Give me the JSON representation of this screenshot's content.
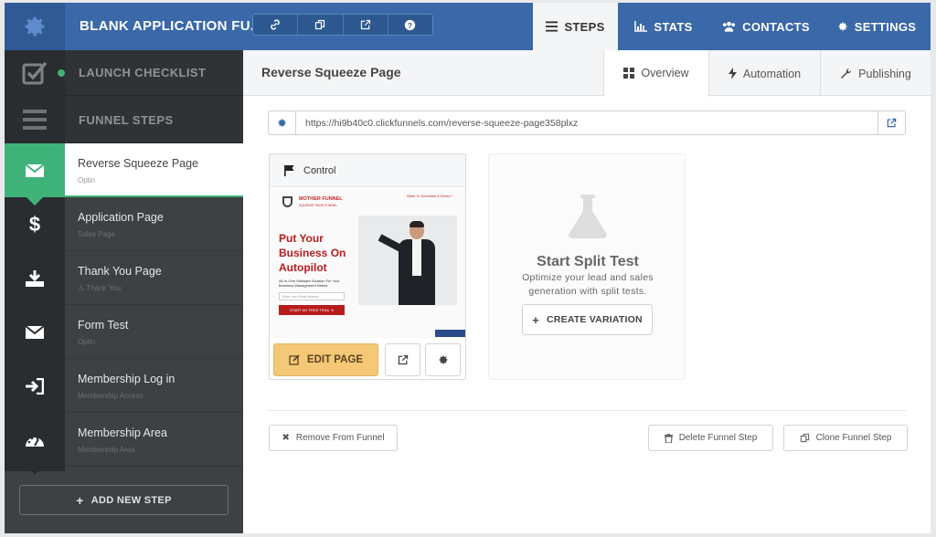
{
  "app": {
    "title": "BLANK APPLICATION FU..."
  },
  "top_nav": [
    {
      "label": "STEPS",
      "icon": "bars-icon"
    },
    {
      "label": "STATS",
      "icon": "bar-chart-icon"
    },
    {
      "label": "CONTACTS",
      "icon": "users-icon"
    },
    {
      "label": "SETTINGS",
      "icon": "gear-icon"
    }
  ],
  "quick_icons": [
    "link-icon",
    "copy-icon",
    "external-link-icon",
    "help-icon"
  ],
  "sidebar": {
    "launch_checklist": "LAUNCH CHECKLIST",
    "funnel_steps": "FUNNEL STEPS",
    "steps": [
      {
        "name": "Reverse Squeeze Page",
        "type": "Optin",
        "icon": "envelope-icon"
      },
      {
        "name": "Application Page",
        "type": "Sales Page",
        "icon": "dollar-icon"
      },
      {
        "name": "Thank You Page",
        "type": "Thank You",
        "icon": "download-icon"
      },
      {
        "name": "Form Test",
        "type": "Optin",
        "icon": "envelope-icon"
      },
      {
        "name": "Membership Log in",
        "type": "Membership Access",
        "icon": "sign-in-icon"
      },
      {
        "name": "Membership Area",
        "type": "Membership Area",
        "icon": "dashboard-icon"
      }
    ],
    "add_step": "ADD NEW STEP"
  },
  "main": {
    "title": "Reverse Squeeze Page",
    "tabs": [
      "Overview",
      "Automation",
      "Publishing"
    ],
    "url": "https://hi9b40c0.clickfunnels.com/reverse-squeeze-page358plxz",
    "variant": {
      "label": "Control",
      "edit": "EDIT PAGE",
      "preview": {
        "brand": "MOTHER FUNNEL",
        "brand_sub": "SQUEEZE PAGE FUNNEL",
        "top_note": "Want To Schedule A Demo?",
        "headline1": "Put Your",
        "headline2": "Business On",
        "headline3": "Autopilot",
        "desc": "All-In-One Software Solution For Your Business Management Needs",
        "input_placeholder": "Enter Your Email Address",
        "cta": "START MY FREE TRIAL ➜"
      }
    },
    "split": {
      "title": "Start Split Test",
      "desc": "Optimize your lead and sales generation with split tests.",
      "button": "CREATE VARIATION"
    },
    "footer": {
      "remove": "Remove From Funnel",
      "delete": "Delete Funnel Step",
      "clone": "Clone Funnel Step"
    }
  },
  "colors": {
    "topbar": "#3a68a8",
    "active_step": "#3fb27a",
    "edit_button": "#f4c877",
    "sidebar": "#3d4144"
  }
}
